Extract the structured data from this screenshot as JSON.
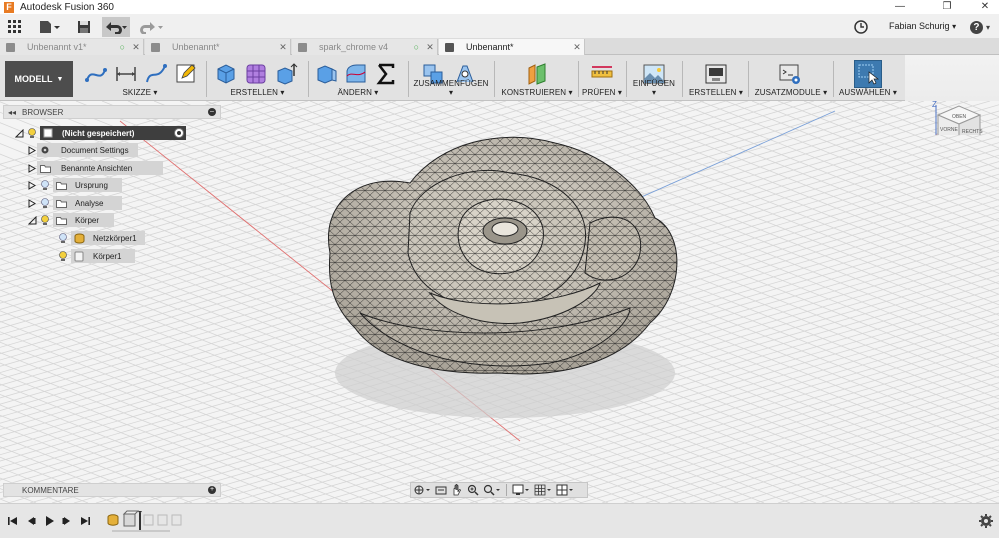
{
  "window": {
    "title": "Autodesk Fusion 360",
    "app_icon_letter": "F",
    "minimize": "—",
    "maximize": "❐",
    "close": "✕"
  },
  "quick_access": {
    "user_name": "Fabian Schurig",
    "help_label": "?"
  },
  "tabs": [
    {
      "name": "Unbenannt v1*",
      "active": false
    },
    {
      "name": "Unbenannt*",
      "active": false
    },
    {
      "name": "spark_chrome v4",
      "active": false
    },
    {
      "name": "Unbenannt*",
      "active": true
    }
  ],
  "ribbon": {
    "workspace": "MODELL",
    "groups": [
      {
        "label": "SKIZZE"
      },
      {
        "label": "ERSTELLEN"
      },
      {
        "label": "ÄNDERN"
      },
      {
        "label": "ZUSAMMENFÜGEN"
      },
      {
        "label": "KONSTRUIEREN"
      },
      {
        "label": "PRÜFEN"
      },
      {
        "label": "EINFÜGEN"
      },
      {
        "label": "ERSTELLEN"
      },
      {
        "label": "ZUSATZMODULE"
      },
      {
        "label": "AUSWÄHLEN"
      }
    ]
  },
  "browser": {
    "header": "BROWSER",
    "root": "(Nicht gespeichert)",
    "items": [
      {
        "label": "Document Settings"
      },
      {
        "label": "Benannte Ansichten"
      },
      {
        "label": "Ursprung"
      },
      {
        "label": "Analyse"
      },
      {
        "label": "Körper"
      },
      {
        "label": "Netzkörper1"
      },
      {
        "label": "Körper1"
      }
    ]
  },
  "viewcube": {
    "top_face": "OBEN",
    "left_face": "VORNE",
    "right_face": "RECHTS",
    "axis_z": "Z",
    "axis_x": "X"
  },
  "comments": {
    "header": "KOMMENTARE"
  },
  "colors": {
    "accent_select": "#3d7ab0",
    "model_fill": "#bfbab0",
    "mesh_line": "#1e1e1e",
    "grid": "#d6d6d6"
  }
}
